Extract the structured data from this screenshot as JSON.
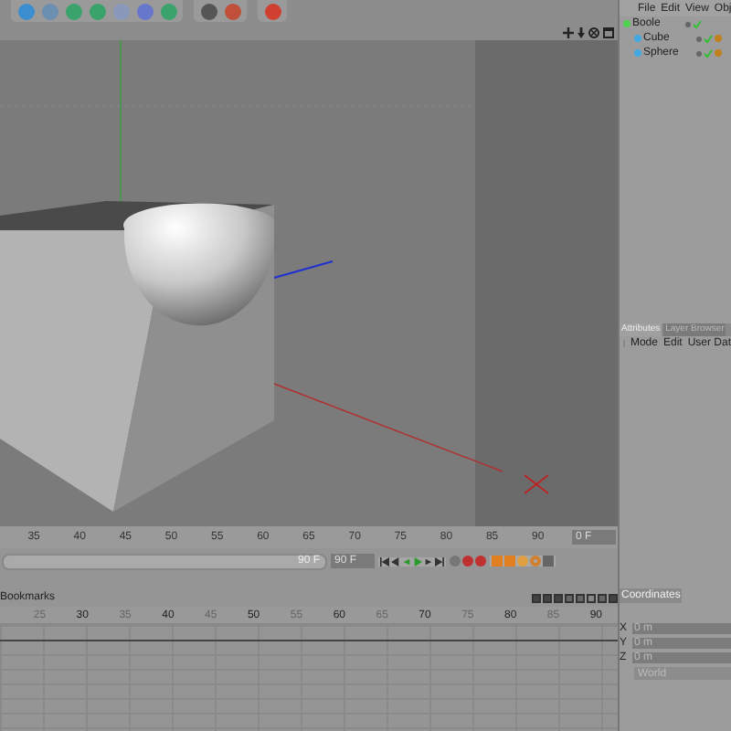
{
  "viewport": {
    "ruler": [
      "35",
      "40",
      "45",
      "50",
      "55",
      "60",
      "65",
      "70",
      "75",
      "80",
      "85",
      "90"
    ],
    "current_frame": "0 F"
  },
  "transport": {
    "level": 1,
    "slider_end": "90 F",
    "end_frame": "90 F"
  },
  "dope_sheet": {
    "title": "Bookmarks",
    "ruler": [
      "25",
      "30",
      "35",
      "40",
      "45",
      "50",
      "55",
      "60",
      "65",
      "70",
      "75",
      "80",
      "85",
      "90"
    ]
  },
  "object_manager": {
    "menu": [
      "File",
      "Edit",
      "View",
      "Obj"
    ],
    "objects": [
      {
        "name": "Boole",
        "enabled": true,
        "children": [
          {
            "name": "Cube",
            "enabled": true
          },
          {
            "name": "Sphere",
            "enabled": true
          }
        ]
      }
    ]
  },
  "attributes": {
    "tabs": [
      {
        "label": "Attributes",
        "selected": true
      },
      {
        "label": "Layer Browser",
        "selected": false
      }
    ],
    "menu": [
      "Mode",
      "Edit",
      "User Dat"
    ]
  },
  "coordinates": {
    "title": "Coordinates",
    "fields": [
      {
        "axis": "X",
        "value": "0 m"
      },
      {
        "axis": "Y",
        "value": "0 m"
      },
      {
        "axis": "Z",
        "value": "0 m"
      }
    ],
    "space": "World"
  }
}
